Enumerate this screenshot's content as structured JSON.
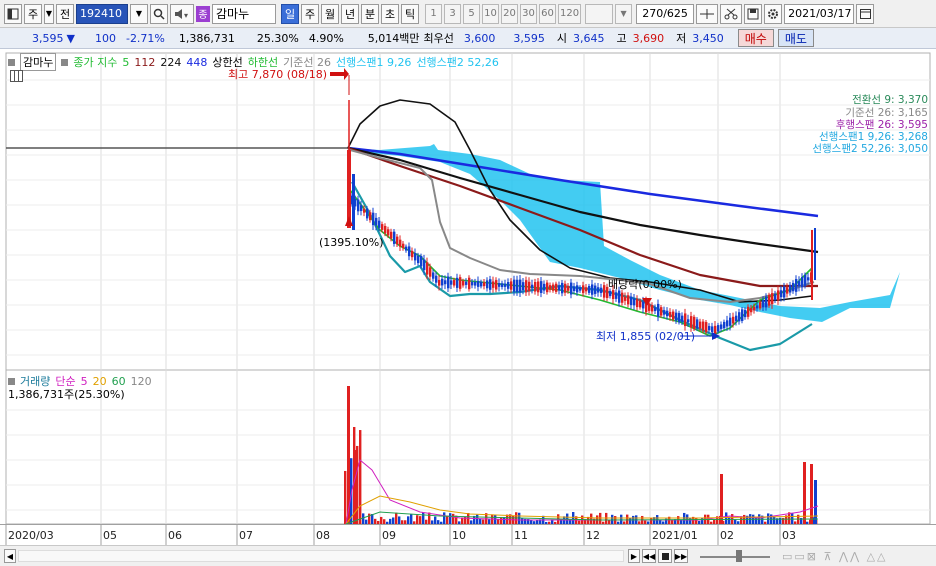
{
  "toolbar": {
    "jeon_label": "전",
    "stock_code": "192410",
    "stock_name": "감마누",
    "badge": "종",
    "periods": [
      "일",
      "주",
      "월",
      "년",
      "분",
      "초",
      "틱"
    ],
    "intervals": [
      "1",
      "3",
      "5",
      "10",
      "20",
      "30",
      "60",
      "120"
    ],
    "count": "270/625",
    "date": "2021/03/17",
    "ju_label": "주"
  },
  "quote": {
    "price": "3,595",
    "change_arrow": "▼",
    "change": "100",
    "change_pct": "-2.71%",
    "volume": "1,386,731",
    "turnover_pct": "25.30%",
    "other_pct": "4.90%",
    "amount": "5,014백만",
    "best_ask_label": "최우선",
    "best_ask": "3,600",
    "best_bid": "3,595",
    "open_label": "시",
    "open": "3,645",
    "high_label": "고",
    "high": "3,690",
    "low_label": "저",
    "low": "3,450",
    "buy_label": "매수",
    "sell_label": "매도"
  },
  "price_legend": {
    "name": "감마누",
    "ma_label": "종가 지수",
    "ma1": "5",
    "ma2": "112",
    "ma3": "224",
    "ma4": "448",
    "upper": "상한선",
    "lower": "하한선",
    "base": "기준선 26",
    "span1": "선행스팬1 9,26",
    "span2": "선행스팬2 52,26"
  },
  "ichimoku_values": {
    "tenkan": "전환선 9: 3,370",
    "kijun": "기준선 26: 3,165",
    "chikou": "후행스팬 26: 3,595",
    "span1": "선행스팬1 9,26: 3,268",
    "span2": "선행스팬2 52,26: 3,050"
  },
  "annotations": {
    "high": "최고 7,870 (08/18)",
    "pct": "(1395.10%)",
    "dividend": "배당락(0.00%)",
    "low": "최저 1,855 (02/01)"
  },
  "volume_legend": {
    "name": "거래량",
    "ma_label": "단순",
    "ma1": "5",
    "ma2": "20",
    "ma3": "60",
    "ma4": "120",
    "value": "1,386,731주(25.30%)"
  },
  "xaxis": {
    "ticks": [
      "2020/03",
      "05",
      "06",
      "07",
      "08",
      "09",
      "10",
      "11",
      "12",
      "2021/01",
      "02",
      "03"
    ]
  },
  "colors": {
    "up": "#e02020",
    "down": "#1040d0",
    "cloud": "#22c3f0",
    "ma5": "#22bb33",
    "ma112": "#8b1a1a",
    "ma224": "#111111",
    "ma448": "#1a2ae0"
  }
}
